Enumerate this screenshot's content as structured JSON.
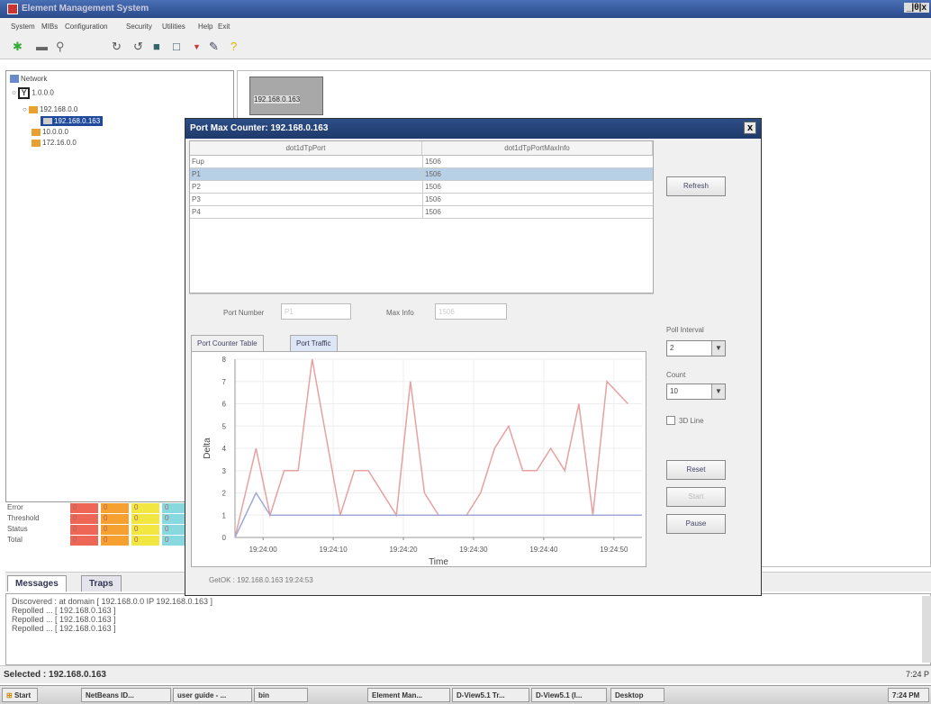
{
  "app": {
    "title": "Element Management System",
    "window_controls": "_|θ|x"
  },
  "menu": [
    "System",
    "MIBs",
    "Configuration",
    "Security",
    "Utilities",
    "Help",
    "Exit"
  ],
  "tree": {
    "root": "Network",
    "nodes": [
      "1.0.0.0",
      "192.168.0.0",
      "192.168.0.163",
      "10.0.0.0",
      "172.16.0.0"
    ]
  },
  "counts": {
    "rows": [
      {
        "label": "Error",
        "values": [
          "0",
          "0",
          "0",
          "0"
        ]
      },
      {
        "label": "Threshold",
        "values": [
          "0",
          "0",
          "0",
          "0"
        ]
      },
      {
        "label": "Status",
        "values": [
          "0",
          "0",
          "0",
          "0"
        ]
      },
      {
        "label": "Total",
        "values": [
          "0",
          "0",
          "0",
          "0"
        ]
      }
    ],
    "colors": [
      "#ee6655",
      "#f6a030",
      "#f2e640",
      "#88d8e0"
    ]
  },
  "device_box": {
    "label": "192.168.0.163"
  },
  "dialog": {
    "title": "Port Max Counter:   192.168.0.163",
    "close": "x",
    "table": {
      "columns": [
        "dot1dTpPort",
        "dot1dTpPortMaxInfo"
      ],
      "rows": [
        [
          "Fup",
          "1506"
        ],
        [
          "P1",
          "1506"
        ],
        [
          "P2",
          "1506"
        ],
        [
          "P3",
          "1506"
        ],
        [
          "P4",
          "1506"
        ]
      ],
      "selected_row": 1
    },
    "port_number_label": "Port Number",
    "port_number_value": "P1",
    "max_info_label": "Max Info",
    "max_info_value": "1506",
    "tabs": [
      "Port Counter Table",
      "Port Traffic"
    ],
    "active_tab": 1,
    "refresh": "Refresh",
    "poll_interval_label": "Poll Interval",
    "poll_interval_value": "2",
    "count_label": "Count",
    "count_value": "10",
    "line3d_label": "3D Line",
    "reset": "Reset",
    "start": "Start",
    "pause": "Pause",
    "status": "GetOK : 192.168.0.163   19:24:53"
  },
  "chart_data": {
    "type": "line",
    "xlabel": "Time",
    "ylabel": "Delta",
    "ylim": [
      0,
      8
    ],
    "y_ticks": [
      "0",
      "1",
      "2",
      "3",
      "4",
      "5",
      "6",
      "7",
      "8"
    ],
    "x_tick_labels": [
      "19:24:00",
      "19:24:10",
      "19:24:20",
      "19:24:30",
      "19:24:40",
      "19:24:50"
    ],
    "x_ticks_seconds": [
      0,
      10,
      20,
      30,
      40,
      50
    ],
    "xlim_seconds": [
      -4,
      54
    ],
    "series": [
      {
        "color": "#e8a0a0",
        "points": [
          [
            -4,
            0
          ],
          [
            -1,
            4
          ],
          [
            1,
            1
          ],
          [
            3,
            3
          ],
          [
            5,
            3
          ],
          [
            7,
            8
          ],
          [
            11,
            1
          ],
          [
            13,
            3
          ],
          [
            15,
            3
          ],
          [
            19,
            1
          ],
          [
            21,
            7
          ],
          [
            23,
            2
          ],
          [
            25,
            1
          ],
          [
            29,
            1
          ],
          [
            31,
            2
          ],
          [
            33,
            4
          ],
          [
            35,
            5
          ],
          [
            37,
            3
          ],
          [
            39,
            3
          ],
          [
            41,
            4
          ],
          [
            43,
            3
          ],
          [
            45,
            6
          ],
          [
            47,
            1
          ],
          [
            49,
            7
          ],
          [
            52,
            6
          ]
        ]
      },
      {
        "color": "#9fa8d8",
        "points": [
          [
            -4,
            0
          ],
          [
            -1,
            2
          ],
          [
            1,
            1
          ],
          [
            54,
            1
          ]
        ]
      }
    ]
  },
  "tabs": [
    "Messages",
    "Traps"
  ],
  "messages": [
    "Discovered : at domain [ 192.168.0.0 IP 192.168.0.163 ]",
    "Repolled ... [ 192.168.0.163 ]",
    "Repolled ... [ 192.168.0.163 ]",
    "Repolled ... [ 192.168.0.163 ]"
  ],
  "status": {
    "selected": "Selected : 192.168.0.163",
    "time": "7:24 P"
  },
  "taskbar": {
    "start": "Start",
    "items": [
      "NetBeans ID...",
      "user guide - ...",
      "bin",
      "Element Man...",
      "D-View5.1 Tr...",
      "D-View5.1 (l...",
      "Desktop"
    ],
    "clock": "7:24 PM"
  }
}
